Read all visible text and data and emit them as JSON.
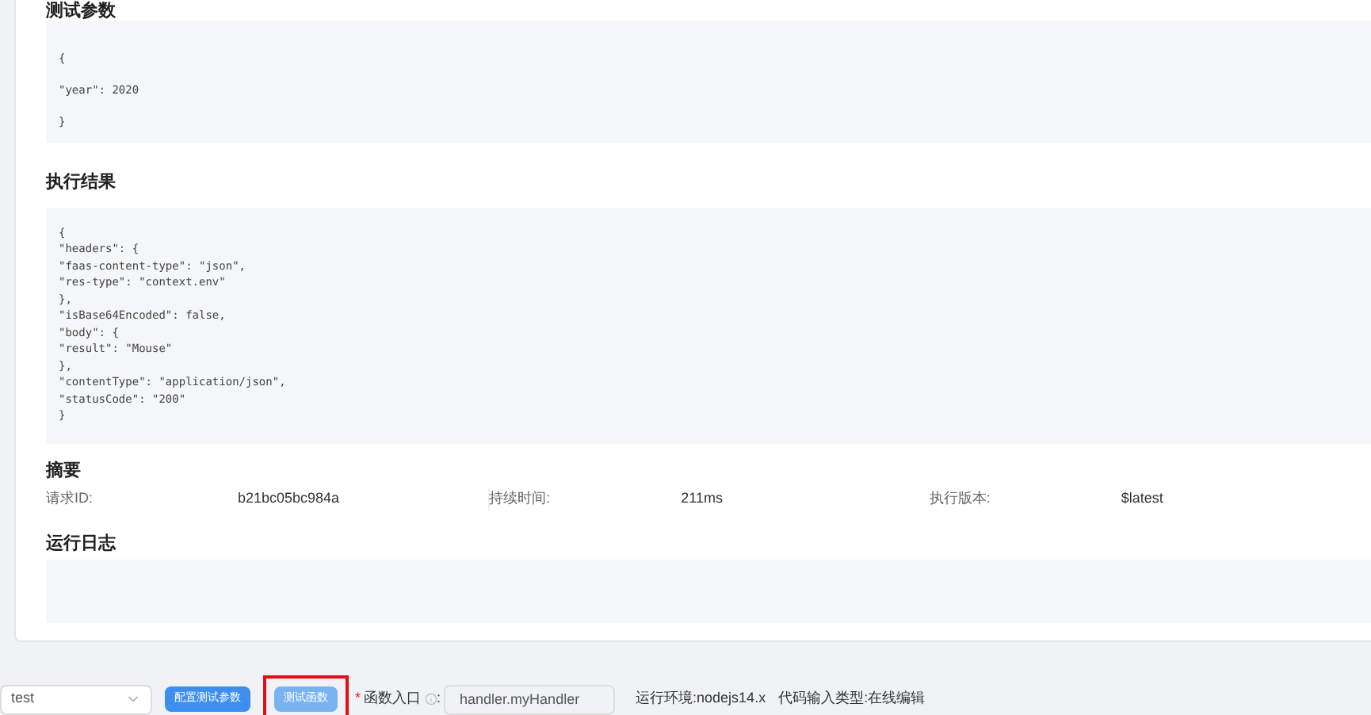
{
  "test_params": {
    "title": "测试参数",
    "lines": [
      "{",
      "\"year\": 2020",
      "}"
    ]
  },
  "result": {
    "title": "执行结果",
    "lines": [
      "{",
      "\"headers\": {",
      "\"faas-content-type\": \"json\",",
      "\"res-type\": \"context.env\"",
      "},",
      "\"isBase64Encoded\": false,",
      "\"body\": {",
      "\"result\": \"Mouse\"",
      "},",
      "\"contentType\": \"application/json\",",
      "\"statusCode\": \"200\"",
      "}"
    ]
  },
  "summary": {
    "title": "摘要",
    "items": [
      {
        "label": "请求ID:",
        "value": "b21bc05bc984a"
      },
      {
        "label": "持续时间:",
        "value": "211ms"
      },
      {
        "label": "执行版本:",
        "value": "$latest"
      }
    ]
  },
  "log": {
    "title": "运行日志"
  },
  "toolbar": {
    "select_value": "test",
    "buttons": [
      {
        "label": "配置测试参数",
        "disabled": false,
        "highlighted": false
      },
      {
        "label": "测试函数",
        "disabled": true,
        "highlighted": true
      }
    ],
    "required_mark": "*",
    "entry_label": "函数入口",
    "colon": ":",
    "entry_value": "handler.myHandler",
    "runtime": "运行环境:nodejs14.x",
    "code_type": "代码输入类型:在线编辑"
  }
}
